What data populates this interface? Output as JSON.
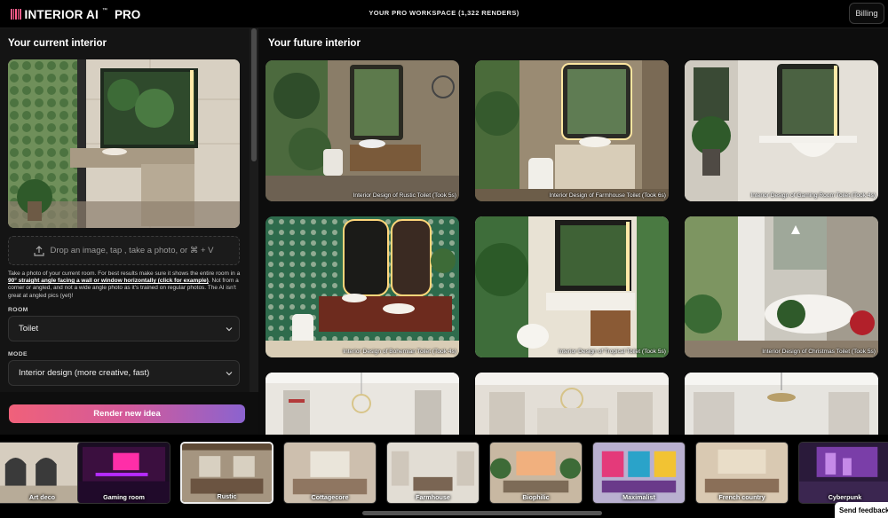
{
  "app": {
    "logo_text": "INTERIOR AI",
    "logo_tm": "™",
    "logo_pro": "PRO",
    "workspace": "YOUR PRO WORKSPACE (1,322 RENDERS)",
    "billing_label": "Billing"
  },
  "left": {
    "title": "Your current interior",
    "dropzone_text": "Drop an image, tap , take a photo, or ⌘ + V",
    "help_pre": "Take a photo of your current room. For best results make sure it shows the entire room in a ",
    "help_link": "90° straight angle facing a wall or window horizontally (click for example)",
    "help_post": ". Not from a corner or angled, and not a wide angle photo as it's trained on regular photos. The AI isn't great at angled pics (yet)!",
    "room_label": "ROOM",
    "room_value": "Toilet",
    "mode_label": "MODE",
    "mode_value": "Interior design (more creative, fast)",
    "render_button": "Render new idea"
  },
  "right": {
    "title": "Your future interior",
    "cards": [
      {
        "caption": "Interior Design of Rustic Toilet (Took 5s)"
      },
      {
        "caption": "Interior Design of Farmhouse Toilet (Took 6s)"
      },
      {
        "caption": "Interior Design of Gaming Room Toilet (Took 4s)"
      },
      {
        "caption": "Interior Design of Bohemian Toilet (Took 4s)"
      },
      {
        "caption": "Interior Design of Tropical Toilet (Took 5s)"
      },
      {
        "caption": "Interior Design of Christmas Toilet (Took 5s)"
      },
      {
        "caption": ""
      },
      {
        "caption": ""
      },
      {
        "caption": ""
      }
    ]
  },
  "styles": [
    {
      "label": "Art deco"
    },
    {
      "label": "Gaming room"
    },
    {
      "label": "Rustic",
      "selected": true
    },
    {
      "label": "Cottagecore"
    },
    {
      "label": "Farmhouse"
    },
    {
      "label": "Biophilic"
    },
    {
      "label": "Maximalist"
    },
    {
      "label": "French country"
    },
    {
      "label": "Cyberpunk"
    }
  ],
  "feedback_label": "Send feedback",
  "colors": {
    "accent_start": "#f0617a",
    "accent_end": "#8b63cf",
    "logo_bars": "#ff5c8a",
    "background": "#000000"
  },
  "icons": [
    "upload-icon",
    "chevron-down-icon"
  ]
}
